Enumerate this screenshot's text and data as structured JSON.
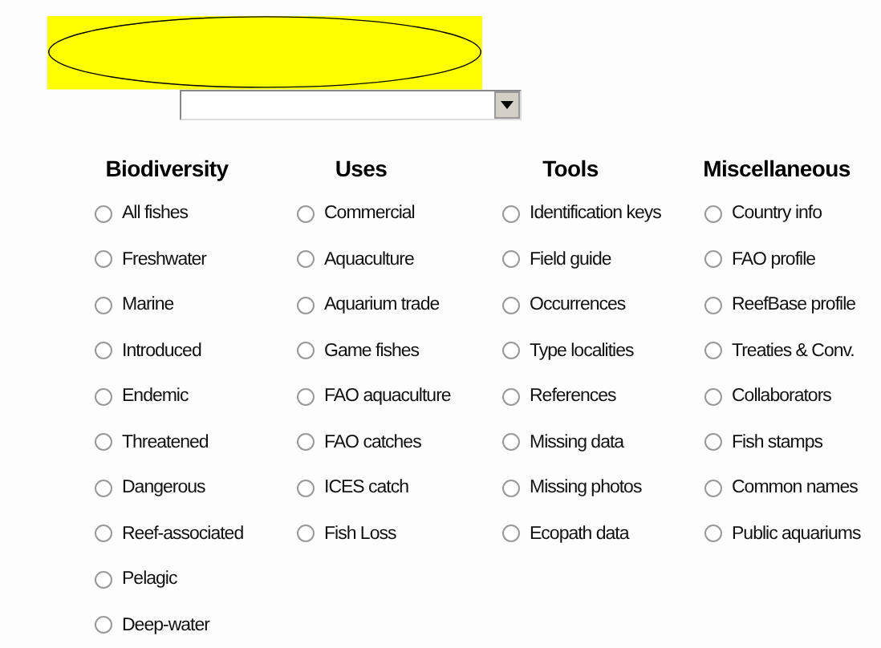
{
  "dropdown": {
    "expanded": false
  },
  "columns": [
    {
      "heading": "Biodiversity",
      "options": [
        {
          "label": "All fishes",
          "selected": false
        },
        {
          "label": "Freshwater",
          "selected": false
        },
        {
          "label": "Marine",
          "selected": false
        },
        {
          "label": "Introduced",
          "selected": false
        },
        {
          "label": "Endemic",
          "selected": false
        },
        {
          "label": "Threatened",
          "selected": false
        },
        {
          "label": "Dangerous",
          "selected": false
        },
        {
          "label": "Reef-associated",
          "selected": false
        },
        {
          "label": "Pelagic",
          "selected": false
        },
        {
          "label": "Deep-water",
          "selected": false
        }
      ]
    },
    {
      "heading": "Uses",
      "options": [
        {
          "label": "Commercial",
          "selected": false
        },
        {
          "label": "Aquaculture",
          "selected": false
        },
        {
          "label": "Aquarium trade",
          "selected": false
        },
        {
          "label": "Game fishes",
          "selected": false
        },
        {
          "label": "FAO aquaculture",
          "selected": false
        },
        {
          "label": "FAO catches",
          "selected": false
        },
        {
          "label": "ICES catch",
          "selected": false
        },
        {
          "label": "Fish Loss",
          "selected": false
        }
      ]
    },
    {
      "heading": "Tools",
      "options": [
        {
          "label": "Identification keys",
          "selected": false
        },
        {
          "label": "Field guide",
          "selected": false
        },
        {
          "label": "Occurrences",
          "selected": false
        },
        {
          "label": "Type localities",
          "selected": false
        },
        {
          "label": "References",
          "selected": false
        },
        {
          "label": "Missing data",
          "selected": false
        },
        {
          "label": "Missing photos",
          "selected": false
        },
        {
          "label": "Ecopath data",
          "selected": false
        }
      ]
    },
    {
      "heading": "Miscellaneous",
      "options": [
        {
          "label": "Country info",
          "selected": false
        },
        {
          "label": "FAO profile",
          "selected": false
        },
        {
          "label": "ReefBase profile",
          "selected": false
        },
        {
          "label": "Treaties & Conv.",
          "selected": false
        },
        {
          "label": "Collaborators",
          "selected": false
        },
        {
          "label": "Fish stamps",
          "selected": false
        },
        {
          "label": "Common names",
          "selected": false
        },
        {
          "label": "Public aquariums",
          "selected": false
        }
      ]
    }
  ]
}
